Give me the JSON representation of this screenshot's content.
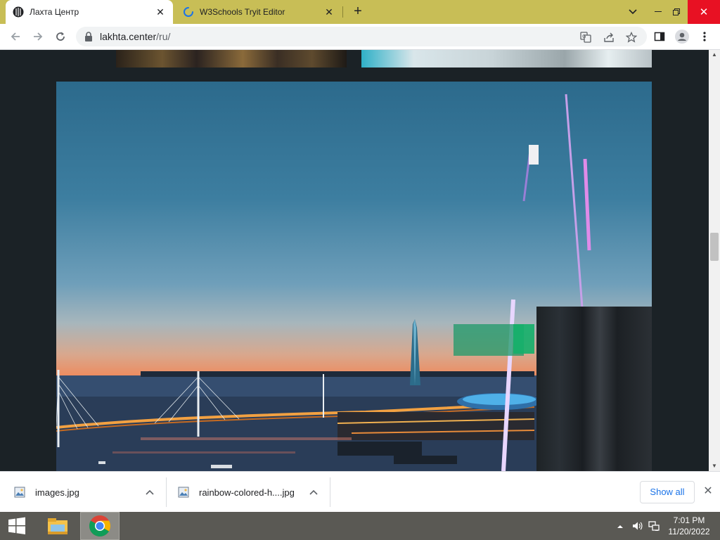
{
  "browser": {
    "tabs": [
      {
        "title": "Лахта Центр",
        "icon": "lakhta-logo-icon",
        "active": true
      },
      {
        "title": "W3Schools Tryit Editor",
        "icon": "loading-spinner-icon",
        "active": false
      }
    ],
    "new_tab_label": "+",
    "address": {
      "host": "lakhta.center",
      "path": "/ru/"
    }
  },
  "page": {
    "hero_alt": "Lakhta Center tower at sunset over the bay"
  },
  "downloads": {
    "items": [
      {
        "filename": "images.jpg"
      },
      {
        "filename": "rainbow-colored-h....jpg"
      }
    ],
    "show_all_label": "Show all"
  },
  "taskbar": {
    "apps": [
      {
        "name": "File Explorer",
        "icon": "file-explorer-icon"
      },
      {
        "name": "Google Chrome",
        "icon": "chrome-icon",
        "active": true
      }
    ],
    "clock": {
      "time": "7:01 PM",
      "date": "11/20/2022"
    }
  },
  "colors": {
    "tabstrip": "#c8be56",
    "close_hover": "#e81123",
    "accent": "#1a73e8"
  }
}
